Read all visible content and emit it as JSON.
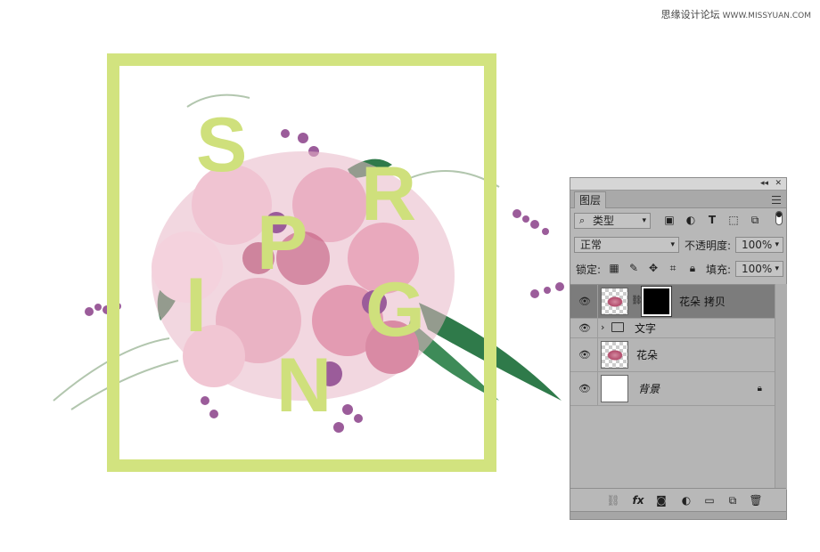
{
  "watermark": {
    "text": "思缘设计论坛",
    "site": "WWW.MISSYUAN.COM"
  },
  "artwork": {
    "letters": [
      "S",
      "R",
      "P",
      "I",
      "G",
      "N"
    ],
    "frame_color": "#d2e37f",
    "letter_color": "#cfe07c"
  },
  "panel": {
    "titlebar": {
      "collapse": "◂◂",
      "close": "✕"
    },
    "tab": "图层",
    "filter": {
      "label": "类型",
      "icons": [
        "image-filter-icon",
        "adjustment-filter-icon",
        "type-filter-icon",
        "shape-filter-icon",
        "smart-object-filter-icon"
      ]
    },
    "blend_mode": "正常",
    "opacity_label": "不透明度:",
    "opacity_value": "100%",
    "lock_label": "锁定:",
    "fill_label": "填充:",
    "fill_value": "100%",
    "layers": [
      {
        "name": "花朵 拷贝",
        "selected": true,
        "has_mask": true
      },
      {
        "name": "文字",
        "type": "group"
      },
      {
        "name": "花朵"
      },
      {
        "name": "背景",
        "locked": true
      }
    ]
  }
}
